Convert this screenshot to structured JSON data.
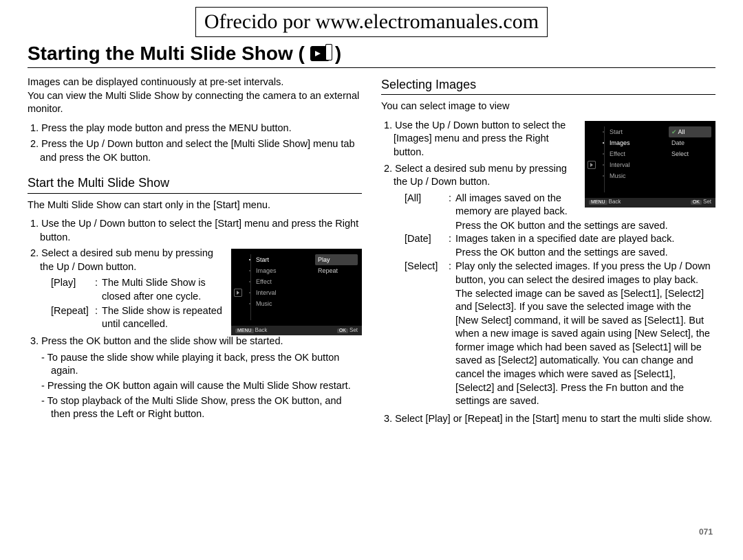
{
  "banner": "Ofrecido por www.electromanuales.com",
  "title_prefix": "Starting the Multi Slide Show (",
  "title_suffix": ")",
  "left": {
    "intro1": "Images can be displayed continuously at pre-set intervals.",
    "intro2": "You can view the Multi Slide Show by connecting the camera to an external monitor.",
    "step1": "1. Press the play mode button and press the MENU button.",
    "step2": "2. Press the Up / Down button and select the [Multi Slide Show] menu tab and press the OK button.",
    "sub_heading": "Start the Multi Slide Show",
    "note": "The Multi Slide Show can start only in the [Start] menu.",
    "s1": "1. Use the Up / Down button to select the [Start] menu and press the Right button.",
    "s2": "2. Select a desired sub menu by pressing the Up / Down button.",
    "def_play_label": "[Play]",
    "def_play_text": "The Multi Slide Show is closed after one cycle.",
    "def_repeat_label": "[Repeat]",
    "def_repeat_text": "The Slide show is repeated until cancelled.",
    "s3": "3. Press the OK button and the slide show will be started.",
    "s3a": "- To pause the slide show while playing it back, press the OK button again.",
    "s3b": "- Pressing the OK button again will cause the Multi Slide Show restart.",
    "s3c": "- To stop playback of the Multi Slide Show, press the OK button, and then press the Left or Right button."
  },
  "right": {
    "sub_heading": "Selecting Images",
    "intro": "You can select image to view",
    "s1": "1. Use the Up / Down button to select the [Images] menu and press the Right button.",
    "s2": "2. Select a desired sub menu by pressing the Up / Down button.",
    "def_all_label": "[All]",
    "def_all_text": "All images saved on the memory are played back.",
    "def_all_text2": "Press the OK button and the settings are saved.",
    "def_date_label": "[Date]",
    "def_date_text": "Images taken in a specified date are played back.",
    "def_date_text2": "Press the OK button and the settings are saved.",
    "def_select_label": "[Select]",
    "def_select_text": "Play only the selected images. If you press the Up / Down button, you can select the desired images to play back. The selected image can be saved as [Select1], [Select2] and [Select3]. If you save the selected image with the [New Select] command, it will be saved as [Select1]. But when a new image is saved again using [New Select], the former image which had been saved as [Select1] will be saved as [Select2] automatically. You can change and cancel the images which were saved as [Select1], [Select2] and [Select3]. Press the Fn button and the settings are saved.",
    "s3": "3. Select [Play] or [Repeat] in the [Start] menu to start the multi slide show."
  },
  "screen1": {
    "menu": [
      "Start",
      "Images",
      "Effect",
      "Interval",
      "Music"
    ],
    "active": "Start",
    "submenu": [
      "Play",
      "Repeat"
    ],
    "selected_sub": "Play",
    "footer_left": "Back",
    "footer_right": "Set",
    "menu_key": "MENU",
    "ok_key": "OK"
  },
  "screen2": {
    "menu": [
      "Start",
      "Images",
      "Effect",
      "Interval",
      "Music"
    ],
    "active": "Images",
    "submenu": [
      "All",
      "Date",
      "Select"
    ],
    "selected_sub": "All",
    "checked_sub": "All",
    "footer_left": "Back",
    "footer_right": "Set",
    "menu_key": "MENU",
    "ok_key": "OK"
  },
  "page_number": "071"
}
